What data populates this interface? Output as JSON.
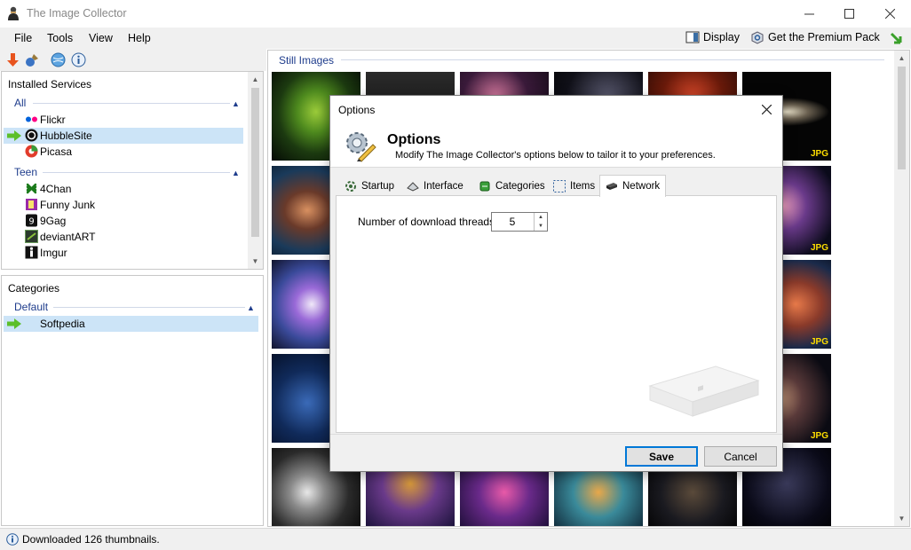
{
  "window": {
    "title": "The Image Collector"
  },
  "menu": {
    "items": [
      "File",
      "Tools",
      "View",
      "Help"
    ],
    "display": "Display",
    "premium": "Get the Premium Pack"
  },
  "services": {
    "header": "Installed Services",
    "groups": [
      {
        "name": "All",
        "items": [
          "Flickr",
          "HubbleSite",
          "Picasa"
        ],
        "selected": 1
      },
      {
        "name": "Teen",
        "items": [
          "4Chan",
          "Funny Junk",
          "9Gag",
          "deviantART",
          "Imgur"
        ]
      }
    ]
  },
  "categories": {
    "header": "Categories",
    "group": "Default",
    "items": [
      "Softpedia"
    ]
  },
  "main": {
    "section": "Still Images",
    "badge": "JPG"
  },
  "status": {
    "text": "Downloaded 126 thumbnails."
  },
  "dialog": {
    "title": "Options",
    "header_title": "Options",
    "header_sub": "Modify The Image Collector's options below to tailor it to your preferences.",
    "tabs": [
      "Startup",
      "Interface",
      "Categories",
      "Items",
      "Network"
    ],
    "active_tab": "Network",
    "threads_label": "Number of download threads",
    "threads_value": "5",
    "save": "Save",
    "cancel": "Cancel"
  },
  "colors": {
    "accent": "#1e3c8c",
    "selection": "#cce4f7",
    "badge": "#ffde00",
    "primary_border": "#0078d7"
  }
}
